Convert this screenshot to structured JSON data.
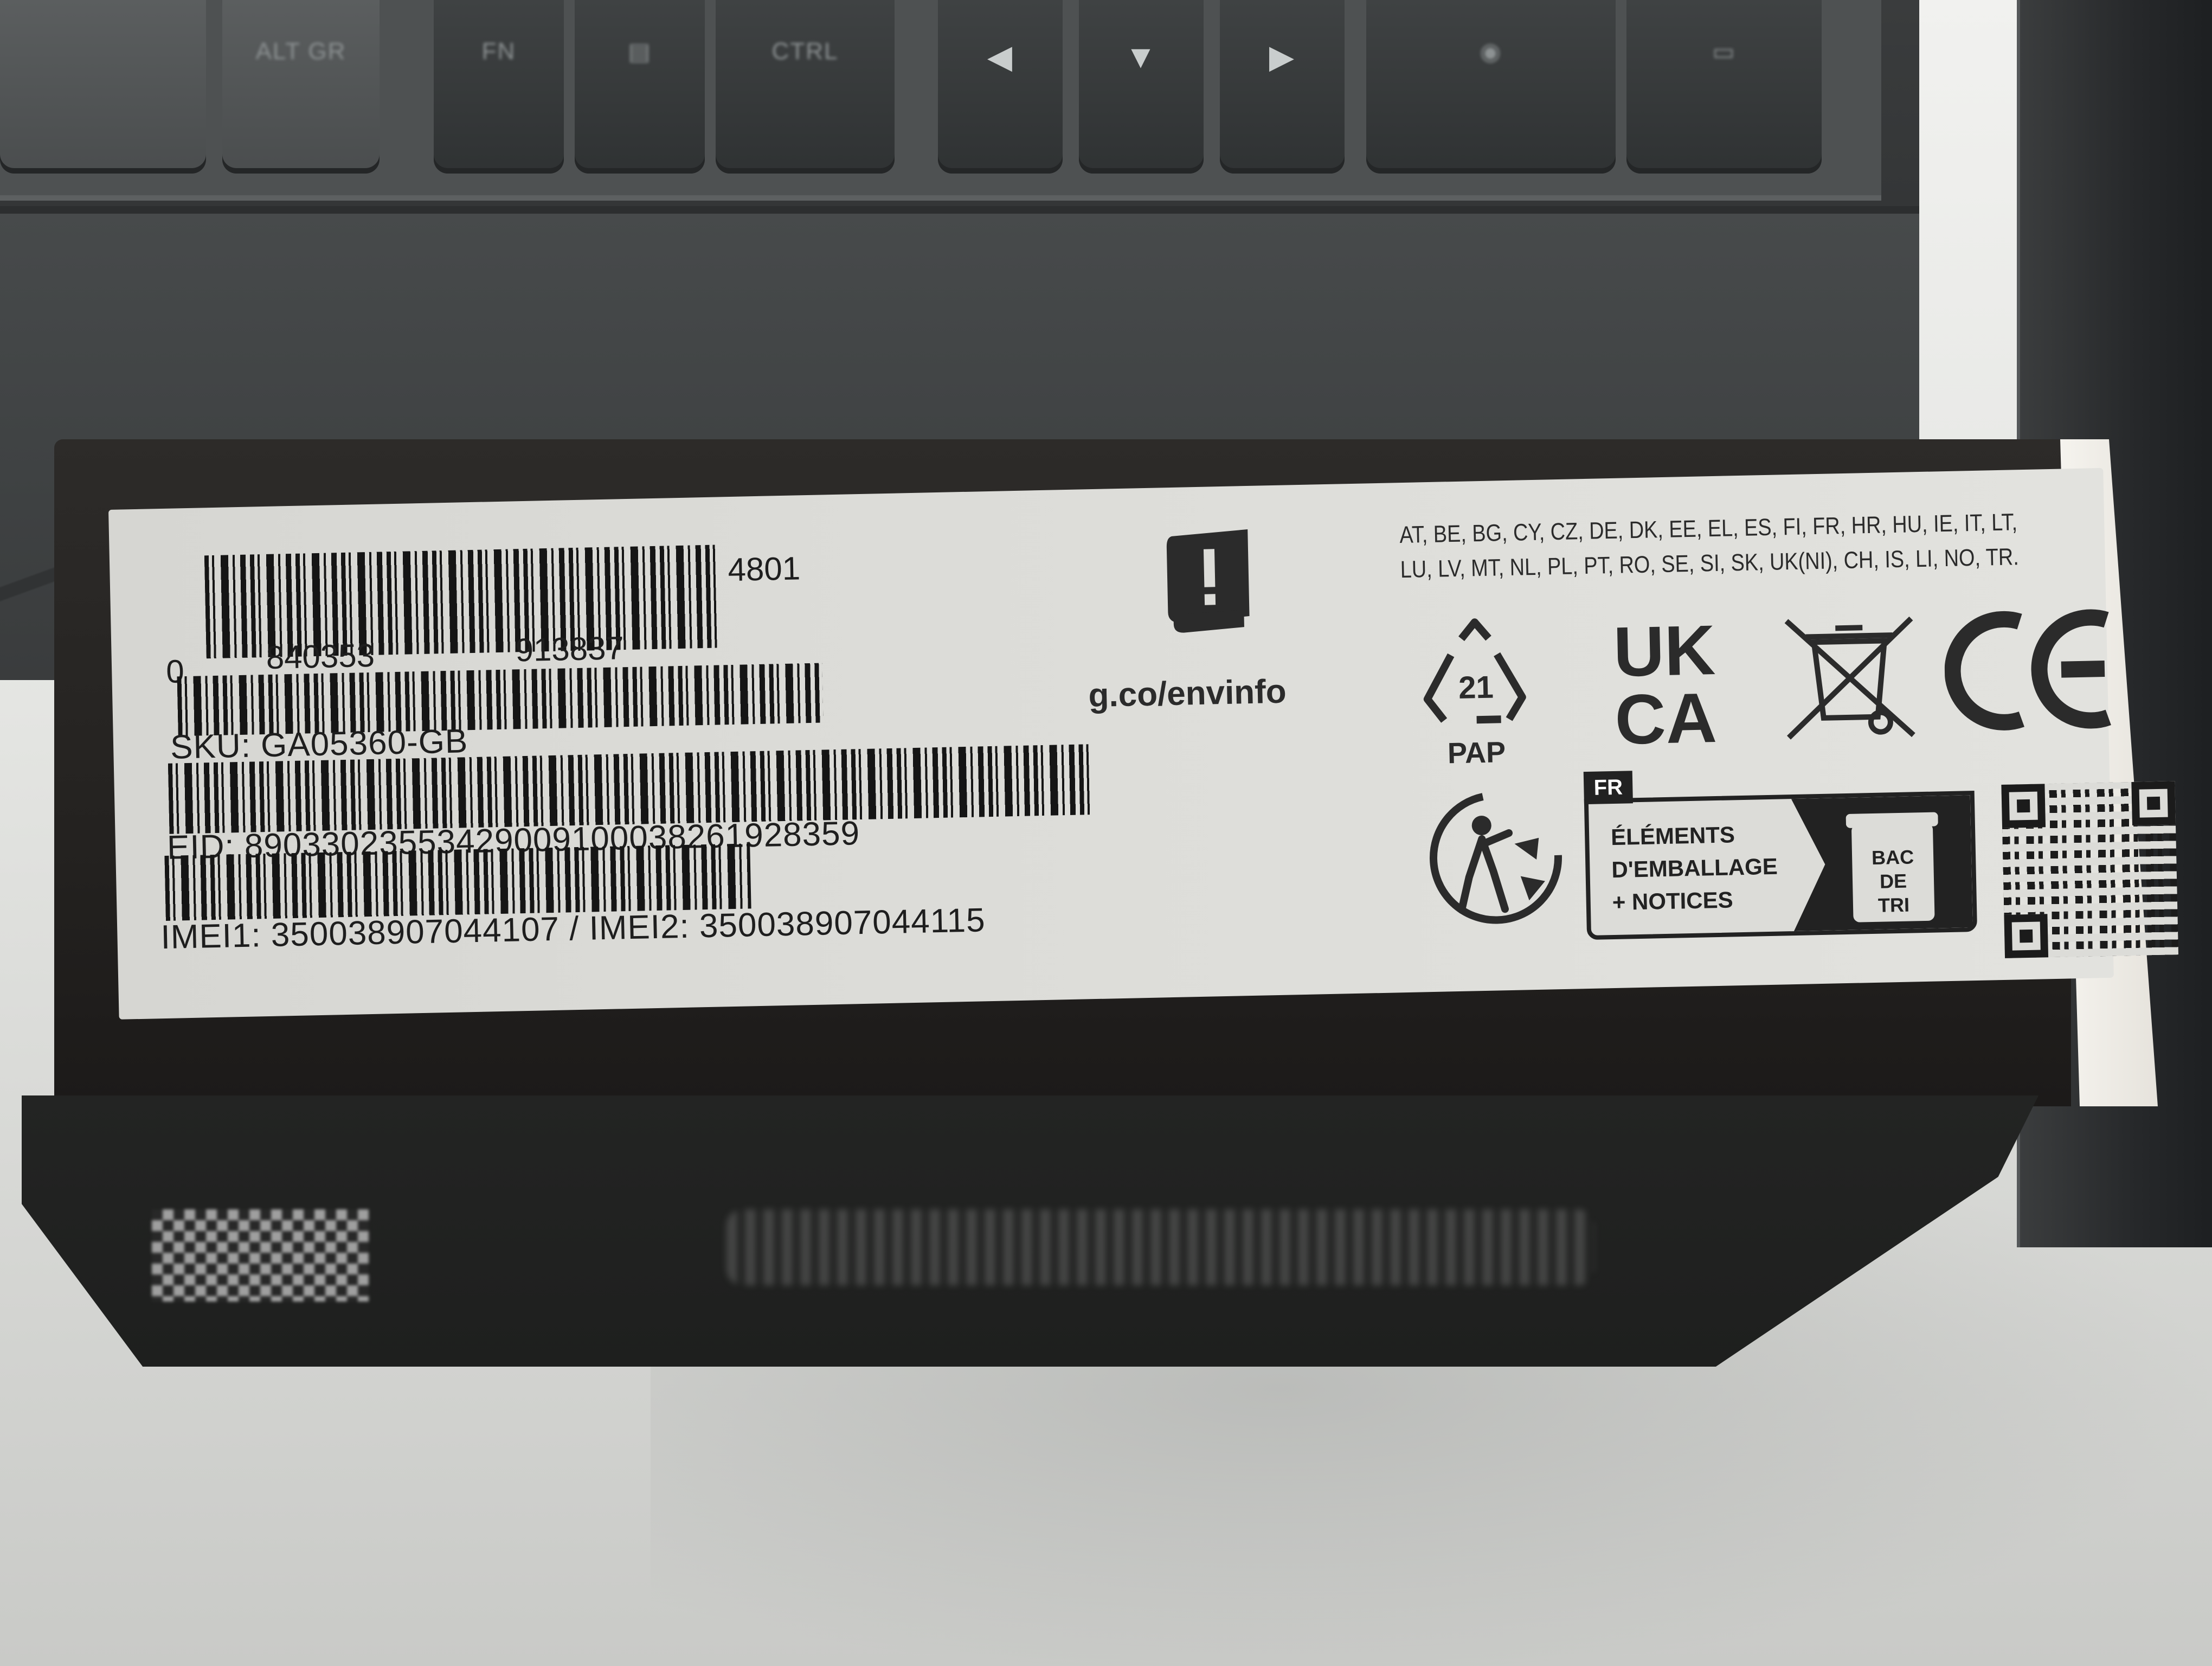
{
  "keyboard": {
    "keys": [
      {
        "legend": "ALT GR"
      },
      {
        "legend": "FN"
      },
      {
        "legend": "▤"
      },
      {
        "legend": "CTRL"
      },
      {
        "legend": "◀"
      },
      {
        "legend": "▼"
      },
      {
        "legend": "▶"
      },
      {
        "legend": "◉"
      },
      {
        "legend": "▭"
      }
    ]
  },
  "label": {
    "ean": {
      "top_number": "4801",
      "lead_digit": "0",
      "left_group": "840353",
      "right_group": "913837"
    },
    "sku": "SKU: GA05360-GB",
    "eid": "EID: 89033023553429009100038261928359",
    "imei": "IMEI1: 350038907044107 / IMEI2: 350038907044115",
    "env_url": "g.co/envinfo",
    "countries": {
      "line1": "AT, BE, BG, CY, CZ, DE, DK, EE, EL, ES, FI, FR, HR, HU, IE, IT, LT,",
      "line2": "LU, LV, MT, NL, PL, PT, RO, SE, SI, SK, UK(NI), CH, IS, LI, NO, TR."
    },
    "recycling": {
      "code": "21",
      "material": "PAP"
    },
    "ukca": {
      "line1": "UK",
      "line2": "CA"
    },
    "ce": "CE",
    "triman": {
      "country_tag": "FR",
      "line1": "ÉLÉMENTS",
      "line2": "D'EMBALLAGE",
      "line3": "+ NOTICES",
      "bin_line1": "BAC",
      "bin_line2": "DE",
      "bin_line3": "TRI"
    },
    "icons": [
      "info-manual-icon",
      "recycling-pap-icon",
      "ukca-mark",
      "crossed-bin-icon",
      "ce-mark",
      "triman-icon",
      "qr-code"
    ]
  },
  "colors": {
    "label_bg": "#dcdcd8",
    "box_dark": "#242220",
    "ink": "#1e1e1e"
  }
}
